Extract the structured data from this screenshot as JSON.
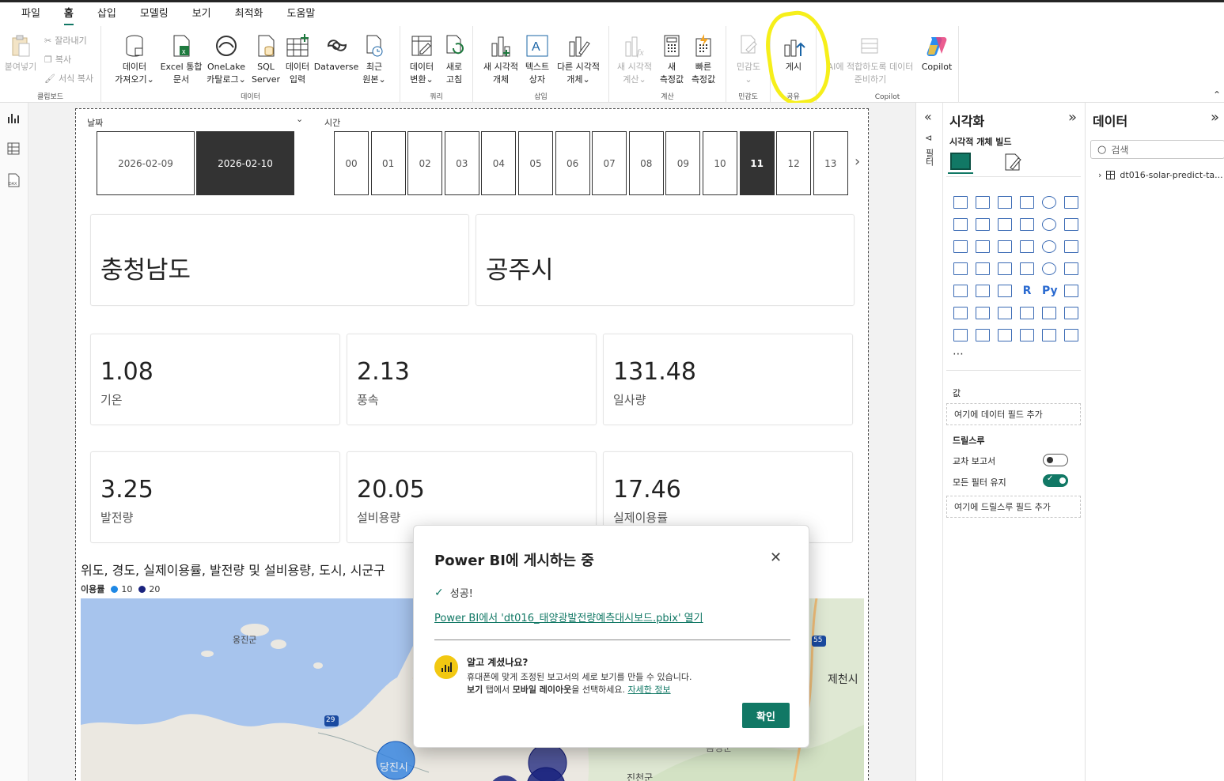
{
  "menu": {
    "tabs": [
      "파일",
      "홈",
      "삽입",
      "모델링",
      "보기",
      "최적화",
      "도움말"
    ],
    "active": "홈"
  },
  "ribbon": {
    "clipboard": {
      "paste": "붙여넣기",
      "cut": "잘라내기",
      "copy": "복사",
      "format": "서식 복사",
      "label": "클립보드"
    },
    "data": {
      "get_data": [
        "데이터",
        "가져오기⌄"
      ],
      "excel": [
        "Excel 통합",
        "문서"
      ],
      "onelake": [
        "OneLake",
        "카탈로그⌄"
      ],
      "sql": [
        "SQL",
        "Server"
      ],
      "enter": [
        "데이터",
        "입력"
      ],
      "dataverse": [
        "Dataverse",
        ""
      ],
      "recent": [
        "최근",
        "원본⌄"
      ],
      "label": "데이터"
    },
    "query": {
      "transform": [
        "데이터",
        "변환⌄"
      ],
      "refresh": [
        "새로",
        "고침"
      ],
      "label": "쿼리"
    },
    "insert": {
      "new_visual": [
        "새 시각적",
        "개체"
      ],
      "textbox": [
        "텍스트",
        "상자"
      ],
      "more_visuals": [
        "다른 시각적",
        "개체⌄"
      ],
      "label": "삽입"
    },
    "calc": {
      "new_calc": [
        "새 시각적",
        "계산⌄"
      ],
      "new_measure": [
        "새",
        "측정값"
      ],
      "quick_measure": [
        "빠른",
        "측정값"
      ],
      "label": "계산"
    },
    "sensitivity": {
      "btn": [
        "민감도",
        "⌄"
      ],
      "label": "민감도"
    },
    "share": {
      "publish": "게시",
      "label": "공유"
    },
    "copilot": {
      "prep": [
        "AI에 적합하도록 데이터",
        "준비하기"
      ],
      "copilot": "Copilot",
      "label": "Copilot"
    }
  },
  "report": {
    "date_slicer": {
      "label": "날짜",
      "options": [
        "2026-02-09",
        "2026-02-10"
      ],
      "selected": "2026-02-10"
    },
    "time_slicer": {
      "label": "시간",
      "options": [
        "00",
        "01",
        "02",
        "03",
        "04",
        "05",
        "06",
        "07",
        "08",
        "09",
        "10",
        "11",
        "12",
        "13"
      ],
      "selected": "11"
    },
    "region": {
      "province": "충청남도",
      "city": "공주시"
    },
    "kpis": [
      {
        "value": "1.08",
        "label": "기온"
      },
      {
        "value": "2.13",
        "label": "풍속"
      },
      {
        "value": "131.48",
        "label": "일사량"
      },
      {
        "value": "3.25",
        "label": "발전량"
      },
      {
        "value": "20.05",
        "label": "설비용량"
      },
      {
        "value": "17.46",
        "label": "실제이용률"
      }
    ],
    "map": {
      "title": "위도, 경도, 실제이용률, 발전량 및 설비용량, 도시, 시군구",
      "legend_title": "이용률",
      "legend": [
        {
          "label": "10",
          "color": "#1e88e5"
        },
        {
          "label": "20",
          "color": "#1a237e"
        }
      ],
      "places": [
        "옹진군",
        "당진시",
        "제천시",
        "진천군",
        "음성군"
      ],
      "roads": [
        "55",
        "29"
      ]
    }
  },
  "vis_pane": {
    "title": "시각화",
    "collapse": "»",
    "filters": "필터",
    "build": "시각적 개체 빌드",
    "more": "⋯",
    "values_label": "값",
    "values_well": "여기에 데이터 필드 추가",
    "drill_label": "드릴스루",
    "cross_report": "교차 보고서",
    "cross_report_on": false,
    "keep_filters": "모든 필터 유지",
    "keep_filters_on": true,
    "drill_well": "여기에 드릴스루 필드 추가"
  },
  "data_pane": {
    "title": "데이터",
    "collapse": "»",
    "search_placeholder": "검색",
    "table": "dt016-solar-predict-ta..."
  },
  "dialog": {
    "title": "Power BI에 게시하는 중",
    "success": "성공!",
    "open_link": "Power BI에서 'dt016_태양광발전량예측대시보드.pbix' 열기",
    "tip_title": "알고 계셨나요?",
    "tip_line1": "휴대폰에 맞게 조정된 보고서의 세로 보기를 만들 수 있습니다.",
    "tip_line2_a": "보기",
    "tip_line2_b": " 탭에서 ",
    "tip_line2_c": "모바일 레이아웃",
    "tip_line2_d": "을 선택하세요. ",
    "tip_more": "자세한 정보",
    "ok": "확인"
  },
  "colors": {
    "accent": "#117865",
    "highlight": "#f6ef1a",
    "selected_slicer": "#333333"
  }
}
